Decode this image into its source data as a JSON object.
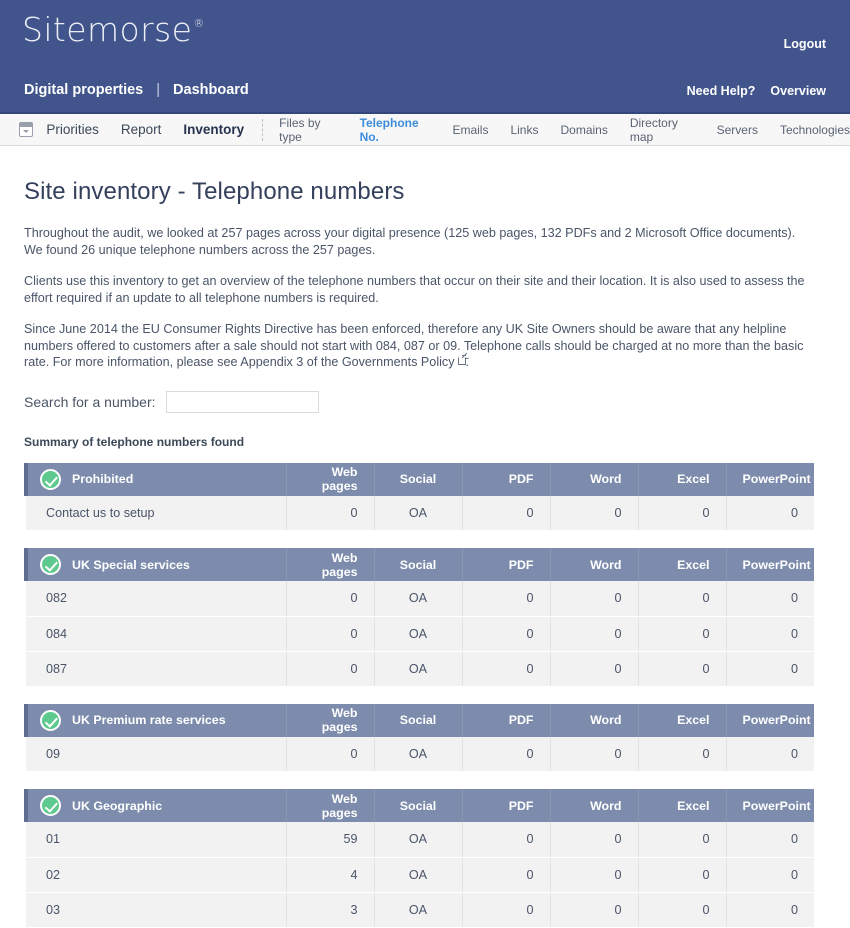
{
  "brand": {
    "logo_text": "Sitemorse",
    "logo_trademark": "®"
  },
  "header": {
    "logout_label": "Logout",
    "breadcrumb": {
      "first": "Digital properties",
      "separator": "|",
      "second": "Dashboard"
    },
    "help_label": "Need Help?",
    "overview_label": "Overview"
  },
  "nav": {
    "calendar_icon": "calendar-icon",
    "main_items": [
      {
        "label": "Priorities",
        "active": false
      },
      {
        "label": "Report",
        "active": false
      },
      {
        "label": "Inventory",
        "active": true
      }
    ],
    "sub_items": [
      {
        "label": "Files by type",
        "active": false
      },
      {
        "label": "Telephone No.",
        "active": true
      },
      {
        "label": "Emails",
        "active": false
      },
      {
        "label": "Links",
        "active": false
      },
      {
        "label": "Domains",
        "active": false
      },
      {
        "label": "Directory map",
        "active": false
      },
      {
        "label": "Servers",
        "active": false
      },
      {
        "label": "Technologies",
        "active": false
      }
    ]
  },
  "main": {
    "title": "Site inventory - Telephone numbers",
    "paragraph_1": "Throughout the audit, we looked at 257 pages across your digital presence (125 web pages, 132 PDFs and 2 Microsoft Office documents). We found 26 unique telephone numbers across the 257 pages.",
    "paragraph_2": "Clients use this inventory to get an overview of the telephone numbers that occur on their site and their location. It is also used to assess the effort required if an update to all telephone numbers is required.",
    "paragraph_3": "Since June 2014 the EU Consumer Rights Directive has been enforced, therefore any UK Site Owners should be aware that any helpline numbers offered to customers after a sale should not start with 084, 087 or 09. Telephone calls should be charged at no more than the basic rate. For more information, please see Appendix 3 of the Governments Policy",
    "paragraph_3_suffix": ".",
    "external_link_icon": "external-link-icon",
    "search": {
      "label": "Search for a number:",
      "value": "",
      "placeholder": ""
    },
    "summary_heading": "Summary of telephone numbers found"
  },
  "tables": {
    "columns": [
      "Web pages",
      "Social",
      "PDF",
      "Word",
      "Excel",
      "PowerPoint"
    ],
    "status_icon": "check-circle-icon",
    "groups": [
      {
        "category": "Prohibited",
        "rows": [
          {
            "number": "Contact us to setup",
            "values": [
              "0",
              "OA",
              "0",
              "0",
              "0",
              "0"
            ]
          }
        ]
      },
      {
        "category": "UK Special services",
        "rows": [
          {
            "number": "082",
            "values": [
              "0",
              "OA",
              "0",
              "0",
              "0",
              "0"
            ]
          },
          {
            "number": "084",
            "values": [
              "0",
              "OA",
              "0",
              "0",
              "0",
              "0"
            ]
          },
          {
            "number": "087",
            "values": [
              "0",
              "OA",
              "0",
              "0",
              "0",
              "0"
            ]
          }
        ]
      },
      {
        "category": "UK Premium rate services",
        "rows": [
          {
            "number": "09",
            "values": [
              "0",
              "OA",
              "0",
              "0",
              "0",
              "0"
            ]
          }
        ]
      },
      {
        "category": "UK Geographic",
        "rows": [
          {
            "number": "01",
            "values": [
              "59",
              "OA",
              "0",
              "0",
              "0",
              "0"
            ]
          },
          {
            "number": "02",
            "values": [
              "4",
              "OA",
              "0",
              "0",
              "0",
              "0"
            ]
          },
          {
            "number": "03",
            "values": [
              "3",
              "OA",
              "0",
              "0",
              "0",
              "0"
            ]
          }
        ]
      }
    ]
  },
  "colors": {
    "brand_blue": "#41558c",
    "table_header": "#7d8cac",
    "accent_link": "#3d8ddd",
    "status_green": "#5ec98e",
    "row_background": "#f2f2f2"
  }
}
